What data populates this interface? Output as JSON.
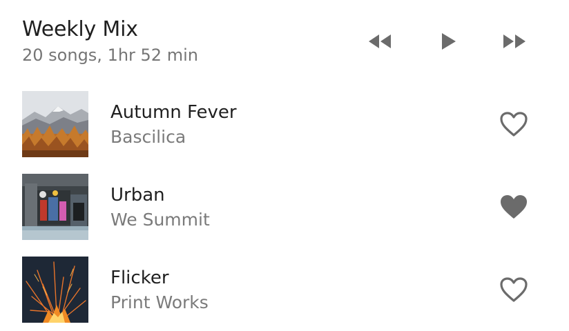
{
  "playlist": {
    "title": "Weekly Mix",
    "summary": "20 songs, 1hr 52 min"
  },
  "controls": {
    "previous_icon": "rewind-icon",
    "play_icon": "play-icon",
    "next_icon": "fast-forward-icon"
  },
  "colors": {
    "icon": "#6b6b6b",
    "title_text": "#1f1f1f",
    "secondary_text": "#757575"
  },
  "tracks": [
    {
      "title": "Autumn Fever",
      "artist": "Bascilica",
      "favorited": false,
      "art": "mountain-forest-artwork"
    },
    {
      "title": "Urban",
      "artist": "We Summit",
      "favorited": true,
      "art": "graffiti-building-artwork"
    },
    {
      "title": "Flicker",
      "artist": "Print Works",
      "favorited": false,
      "art": "fire-sparks-artwork"
    }
  ]
}
